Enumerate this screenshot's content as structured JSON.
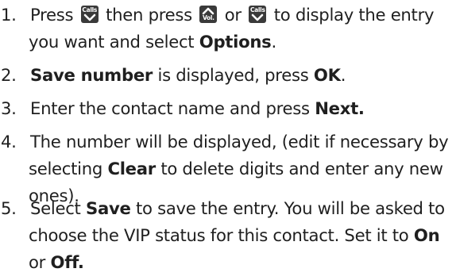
{
  "steps": [
    {
      "number": "1.",
      "parts": {
        "a": "Press",
        "b": "then press",
        "c": "or",
        "d": "to display the entry",
        "e": "you want and select",
        "f": "Options",
        "g": "."
      }
    },
    {
      "number": "2.",
      "parts": {
        "a": "Save number",
        "b": " is displayed, press ",
        "c": "OK",
        "d": "."
      }
    },
    {
      "number": "3.",
      "parts": {
        "a": "Enter the contact name and press ",
        "b": "Next."
      }
    },
    {
      "number": "4.",
      "parts": {
        "a": "The number will be displayed, (edit if necessary by",
        "b": "selecting ",
        "c": "Clear",
        "d": " to delete digits and enter any new",
        "e": "ones)."
      }
    },
    {
      "number": "5.",
      "parts": {
        "a": "Select ",
        "b": "Save",
        "c": " to save the entry. You will be asked to",
        "d": "choose the VIP status for this contact. Set it to ",
        "e": "On",
        "f": "or ",
        "g": "Off."
      }
    }
  ],
  "keys": {
    "calls_label": "Calls",
    "vol_label": "Vol.",
    "calls_icon": "chevron-down-icon",
    "vol_icon": "chevron-up-icon",
    "key_color": "#3a3a3a"
  }
}
